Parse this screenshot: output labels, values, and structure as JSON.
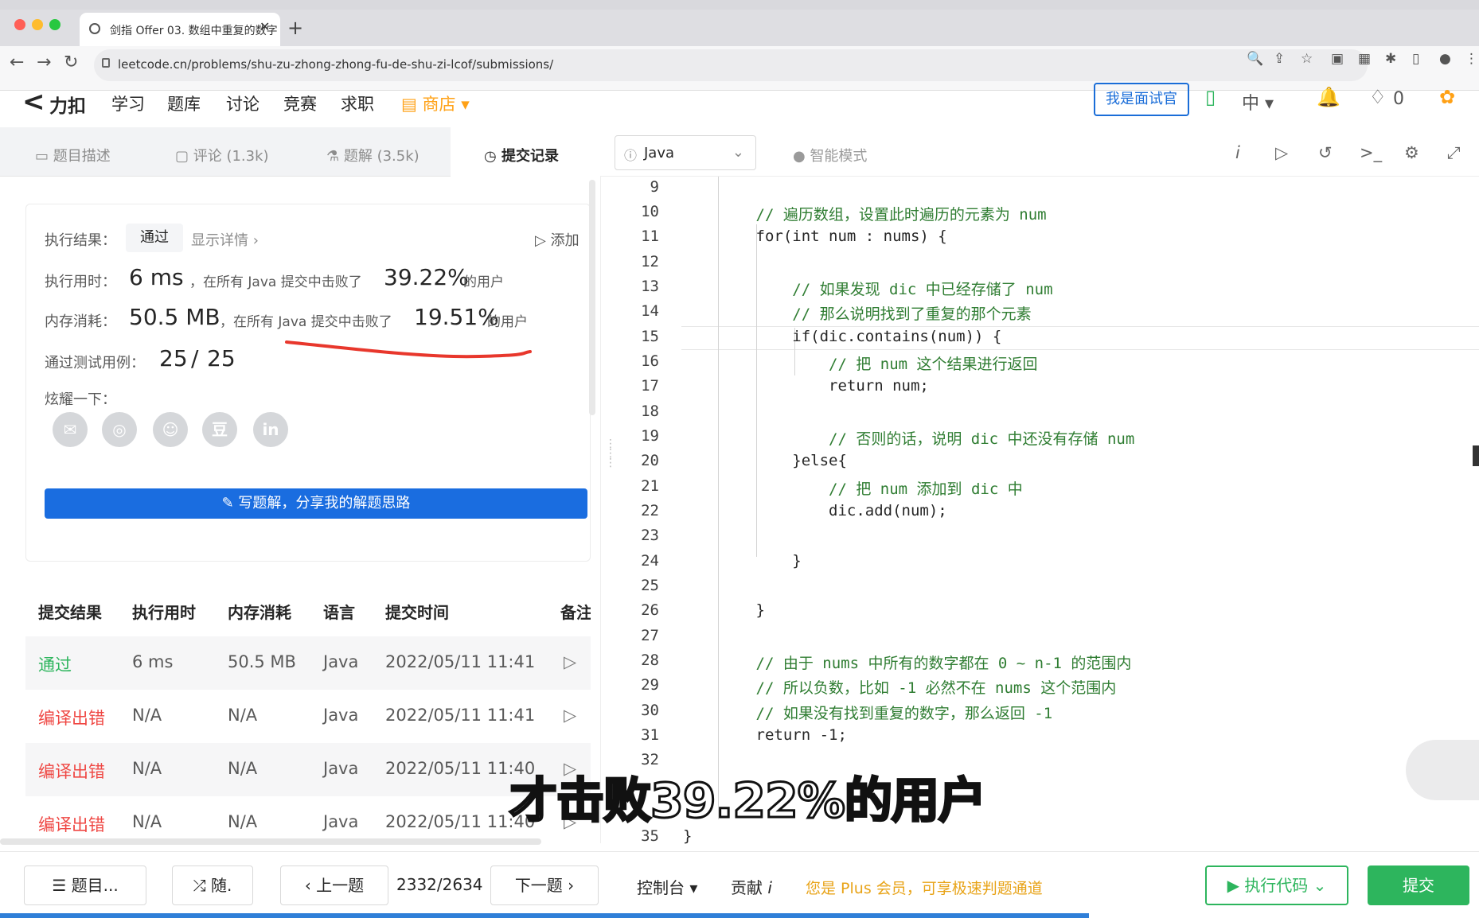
{
  "browser": {
    "tab_title": "剑指 Offer 03. 数组中重复的数字",
    "url": "leetcode.cn/problems/shu-zu-zhong-zhong-fu-de-shu-zi-lcof/submissions/"
  },
  "header": {
    "logo": "力扣",
    "nav": [
      "学习",
      "题库",
      "讨论",
      "竞赛",
      "求职"
    ],
    "shop": "商店",
    "interview_button": "我是面试官",
    "lang": "中",
    "points": "0"
  },
  "left_tabs": [
    "题目描述",
    "评论 (1.3k)",
    "题解 (3.5k)",
    "提交记录"
  ],
  "result": {
    "label_result": "执行结果：",
    "status": "通过",
    "show_details": "显示详情",
    "add_note": "添加",
    "label_time": "执行用时：",
    "time_value": "6 ms",
    "time_desc": "，在所有 Java 提交中击败了",
    "time_pct": "39.22%",
    "users_suffix": "的用户",
    "label_mem": "内存消耗：",
    "mem_value": "50.5 MB",
    "mem_desc": "，在所有 Java 提交中击败了",
    "mem_pct": "19.51%",
    "label_cases": "通过测试用例：",
    "cases_passed": "25",
    "cases_sep": "/",
    "cases_total": "25",
    "label_share": "炫耀一下：",
    "share_icons": [
      "wechat-icon",
      "weibo-icon",
      "qq-icon",
      "douban-icon",
      "linkedin-icon"
    ],
    "write_solution": "写题解，分享我的解题思路"
  },
  "submissions": {
    "headers": [
      "提交结果",
      "执行用时",
      "内存消耗",
      "语言",
      "提交时间",
      "备注"
    ],
    "rows": [
      {
        "status": "通过",
        "time": "6 ms",
        "memory": "50.5 MB",
        "lang": "Java",
        "submitted": "2022/05/11 11:41"
      },
      {
        "status": "编译出错",
        "time": "N/A",
        "memory": "N/A",
        "lang": "Java",
        "submitted": "2022/05/11 11:41"
      },
      {
        "status": "编译出错",
        "time": "N/A",
        "memory": "N/A",
        "lang": "Java",
        "submitted": "2022/05/11 11:40"
      },
      {
        "status": "编译出错",
        "time": "N/A",
        "memory": "N/A",
        "lang": "Java",
        "submitted": "2022/05/11 11:40"
      }
    ]
  },
  "editor": {
    "language": "Java",
    "mode": "智能模式",
    "line_numbers": [
      "9",
      "10",
      "11",
      "12",
      "13",
      "14",
      "15",
      "16",
      "17",
      "18",
      "19",
      "20",
      "21",
      "22",
      "23",
      "24",
      "25",
      "26",
      "27",
      "28",
      "29",
      "30",
      "31",
      "32",
      "35"
    ],
    "lines": [
      "",
      "        // 遍历数组，设置此时遍历的元素为 num",
      "        for(int num : nums) {",
      "",
      "            // 如果发现 dic 中已经存储了 num",
      "            // 那么说明找到了重复的那个元素",
      "            if(dic.contains(num)) {",
      "                // 把 num 这个结果进行返回",
      "                return num;",
      "",
      "                // 否则的话，说明 dic 中还没有存储 num",
      "            }else{",
      "                // 把 num 添加到 dic 中",
      "                dic.add(num);",
      "",
      "            }",
      "",
      "        }",
      "",
      "        // 由于 nums 中所有的数字都在 0 ~ n-1 的范围内",
      "        // 所以负数，比如 -1 必然不在 nums 这个范围内",
      "        // 如果没有找到重复的数字，那么返回 -1",
      "        return -1;",
      "",
      "}"
    ]
  },
  "caption": "才击败39.22%的用户",
  "footer": {
    "problems": "题目...",
    "random": "随.",
    "prev": "上一题",
    "progress": "2332/2634",
    "next": "下一题",
    "console": "控制台",
    "contribute": "贡献",
    "plus_notice": "您是 Plus 会员，可享极速判题通道",
    "run": "执行代码",
    "submit": "提交"
  },
  "colors": {
    "accent_blue": "#1a6de0",
    "pass_green": "#2db55d",
    "error_red": "#ef4743",
    "shop_orange": "#ffa116"
  }
}
